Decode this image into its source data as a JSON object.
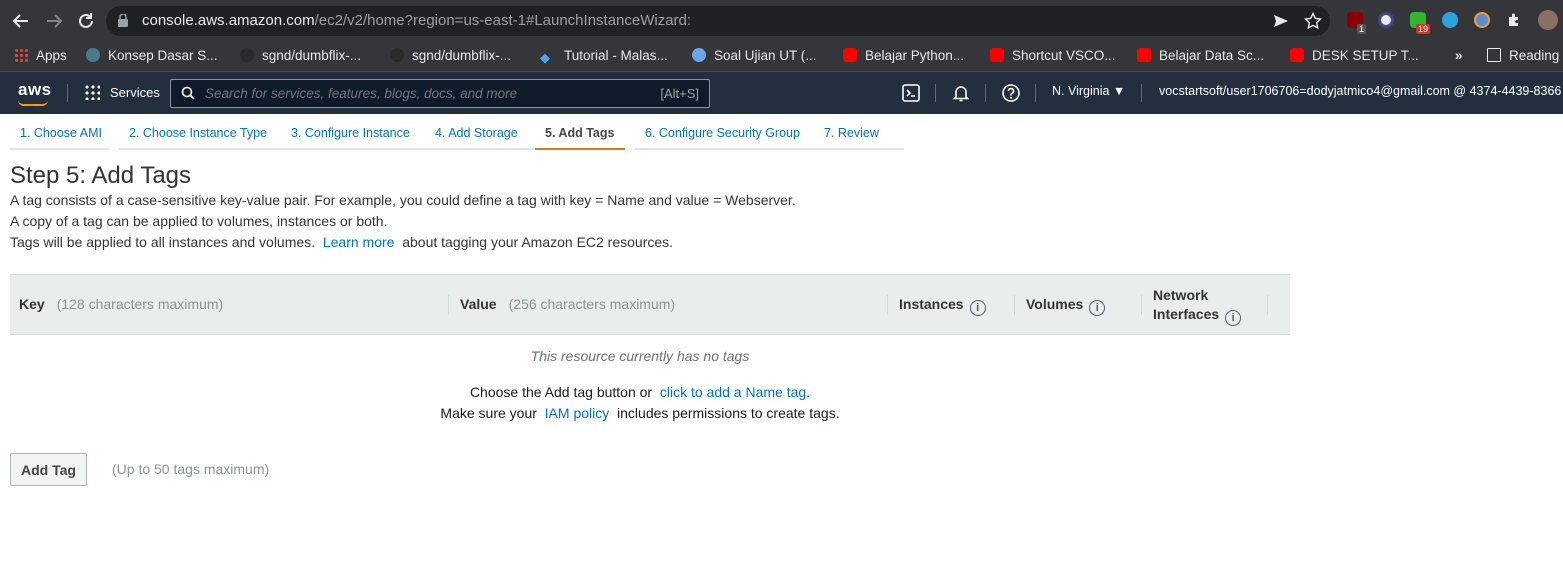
{
  "browser": {
    "url_host": "console.aws.amazon.com",
    "url_path": "/ec2/v2/home?region=us-east-1#LaunchInstanceWizard:",
    "extension_badge_1": "1",
    "extension_badge_2": "19",
    "bookmarks": [
      {
        "label": "Apps",
        "icon": "apps-grid-icon"
      },
      {
        "label": "Konsep Dasar S...",
        "icon": "site-icon"
      },
      {
        "label": "sgnd/dumbflix-...",
        "icon": "github-icon"
      },
      {
        "label": "sgnd/dumbflix-...",
        "icon": "github-icon"
      },
      {
        "label": "Tutorial - Malas...",
        "icon": "code-icon"
      },
      {
        "label": "Soal Ujian UT (...",
        "icon": "site-icon"
      },
      {
        "label": "Belajar Python...",
        "icon": "youtube-icon"
      },
      {
        "label": "Shortcut VSCO...",
        "icon": "youtube-icon"
      },
      {
        "label": "Belajar Data Sc...",
        "icon": "youtube-icon"
      },
      {
        "label": "DESK SETUP T...",
        "icon": "youtube-icon"
      }
    ],
    "overflow": "»",
    "reading_list": "Reading"
  },
  "aws": {
    "logo": "aws",
    "services_label": "Services",
    "search_placeholder": "Search for services, features, blogs, docs, and more",
    "search_shortcut": "[Alt+S]",
    "region": "N. Virginia ▼",
    "account": "vocstartsoft/user1706706=dodyjatmico4@gmail.com @ 4374-4439-8366"
  },
  "wizard": {
    "tabs": [
      {
        "label": "1. Choose AMI"
      },
      {
        "label": "2. Choose Instance Type"
      },
      {
        "label": "3. Configure Instance"
      },
      {
        "label": "4. Add Storage"
      },
      {
        "label": "5. Add Tags"
      },
      {
        "label": "6. Configure Security Group"
      },
      {
        "label": "7. Review"
      }
    ],
    "active_tab": "5. Add Tags"
  },
  "content": {
    "title": "Step 5: Add Tags",
    "desc_1": "A tag consists of a case-sensitive key-value pair. For example, you could define a tag with key = Name and value = Webserver.",
    "desc_2": "A copy of a tag can be applied to volumes, instances or both.",
    "desc_3_before": "Tags will be applied to all instances and volumes.",
    "desc_3_link": "Learn more",
    "desc_3_after": "about tagging your Amazon EC2 resources.",
    "table": {
      "key_header": "Key",
      "key_hint": "(128 characters maximum)",
      "value_header": "Value",
      "value_hint": "(256 characters maximum)",
      "instances_header": "Instances",
      "volumes_header": "Volumes",
      "network_header_1": "Network",
      "network_header_2": "Interfaces",
      "info_glyph": "i"
    },
    "empty_message": "This resource currently has no tags",
    "choose_before": "Choose the Add tag button or",
    "choose_link": "click to add a Name tag",
    "choose_after": ".",
    "iam_before": "Make sure your",
    "iam_link": "IAM policy",
    "iam_after": "includes permissions to create tags.",
    "add_tag_button": "Add Tag",
    "add_tag_hint": "(Up to 50 tags maximum)"
  }
}
